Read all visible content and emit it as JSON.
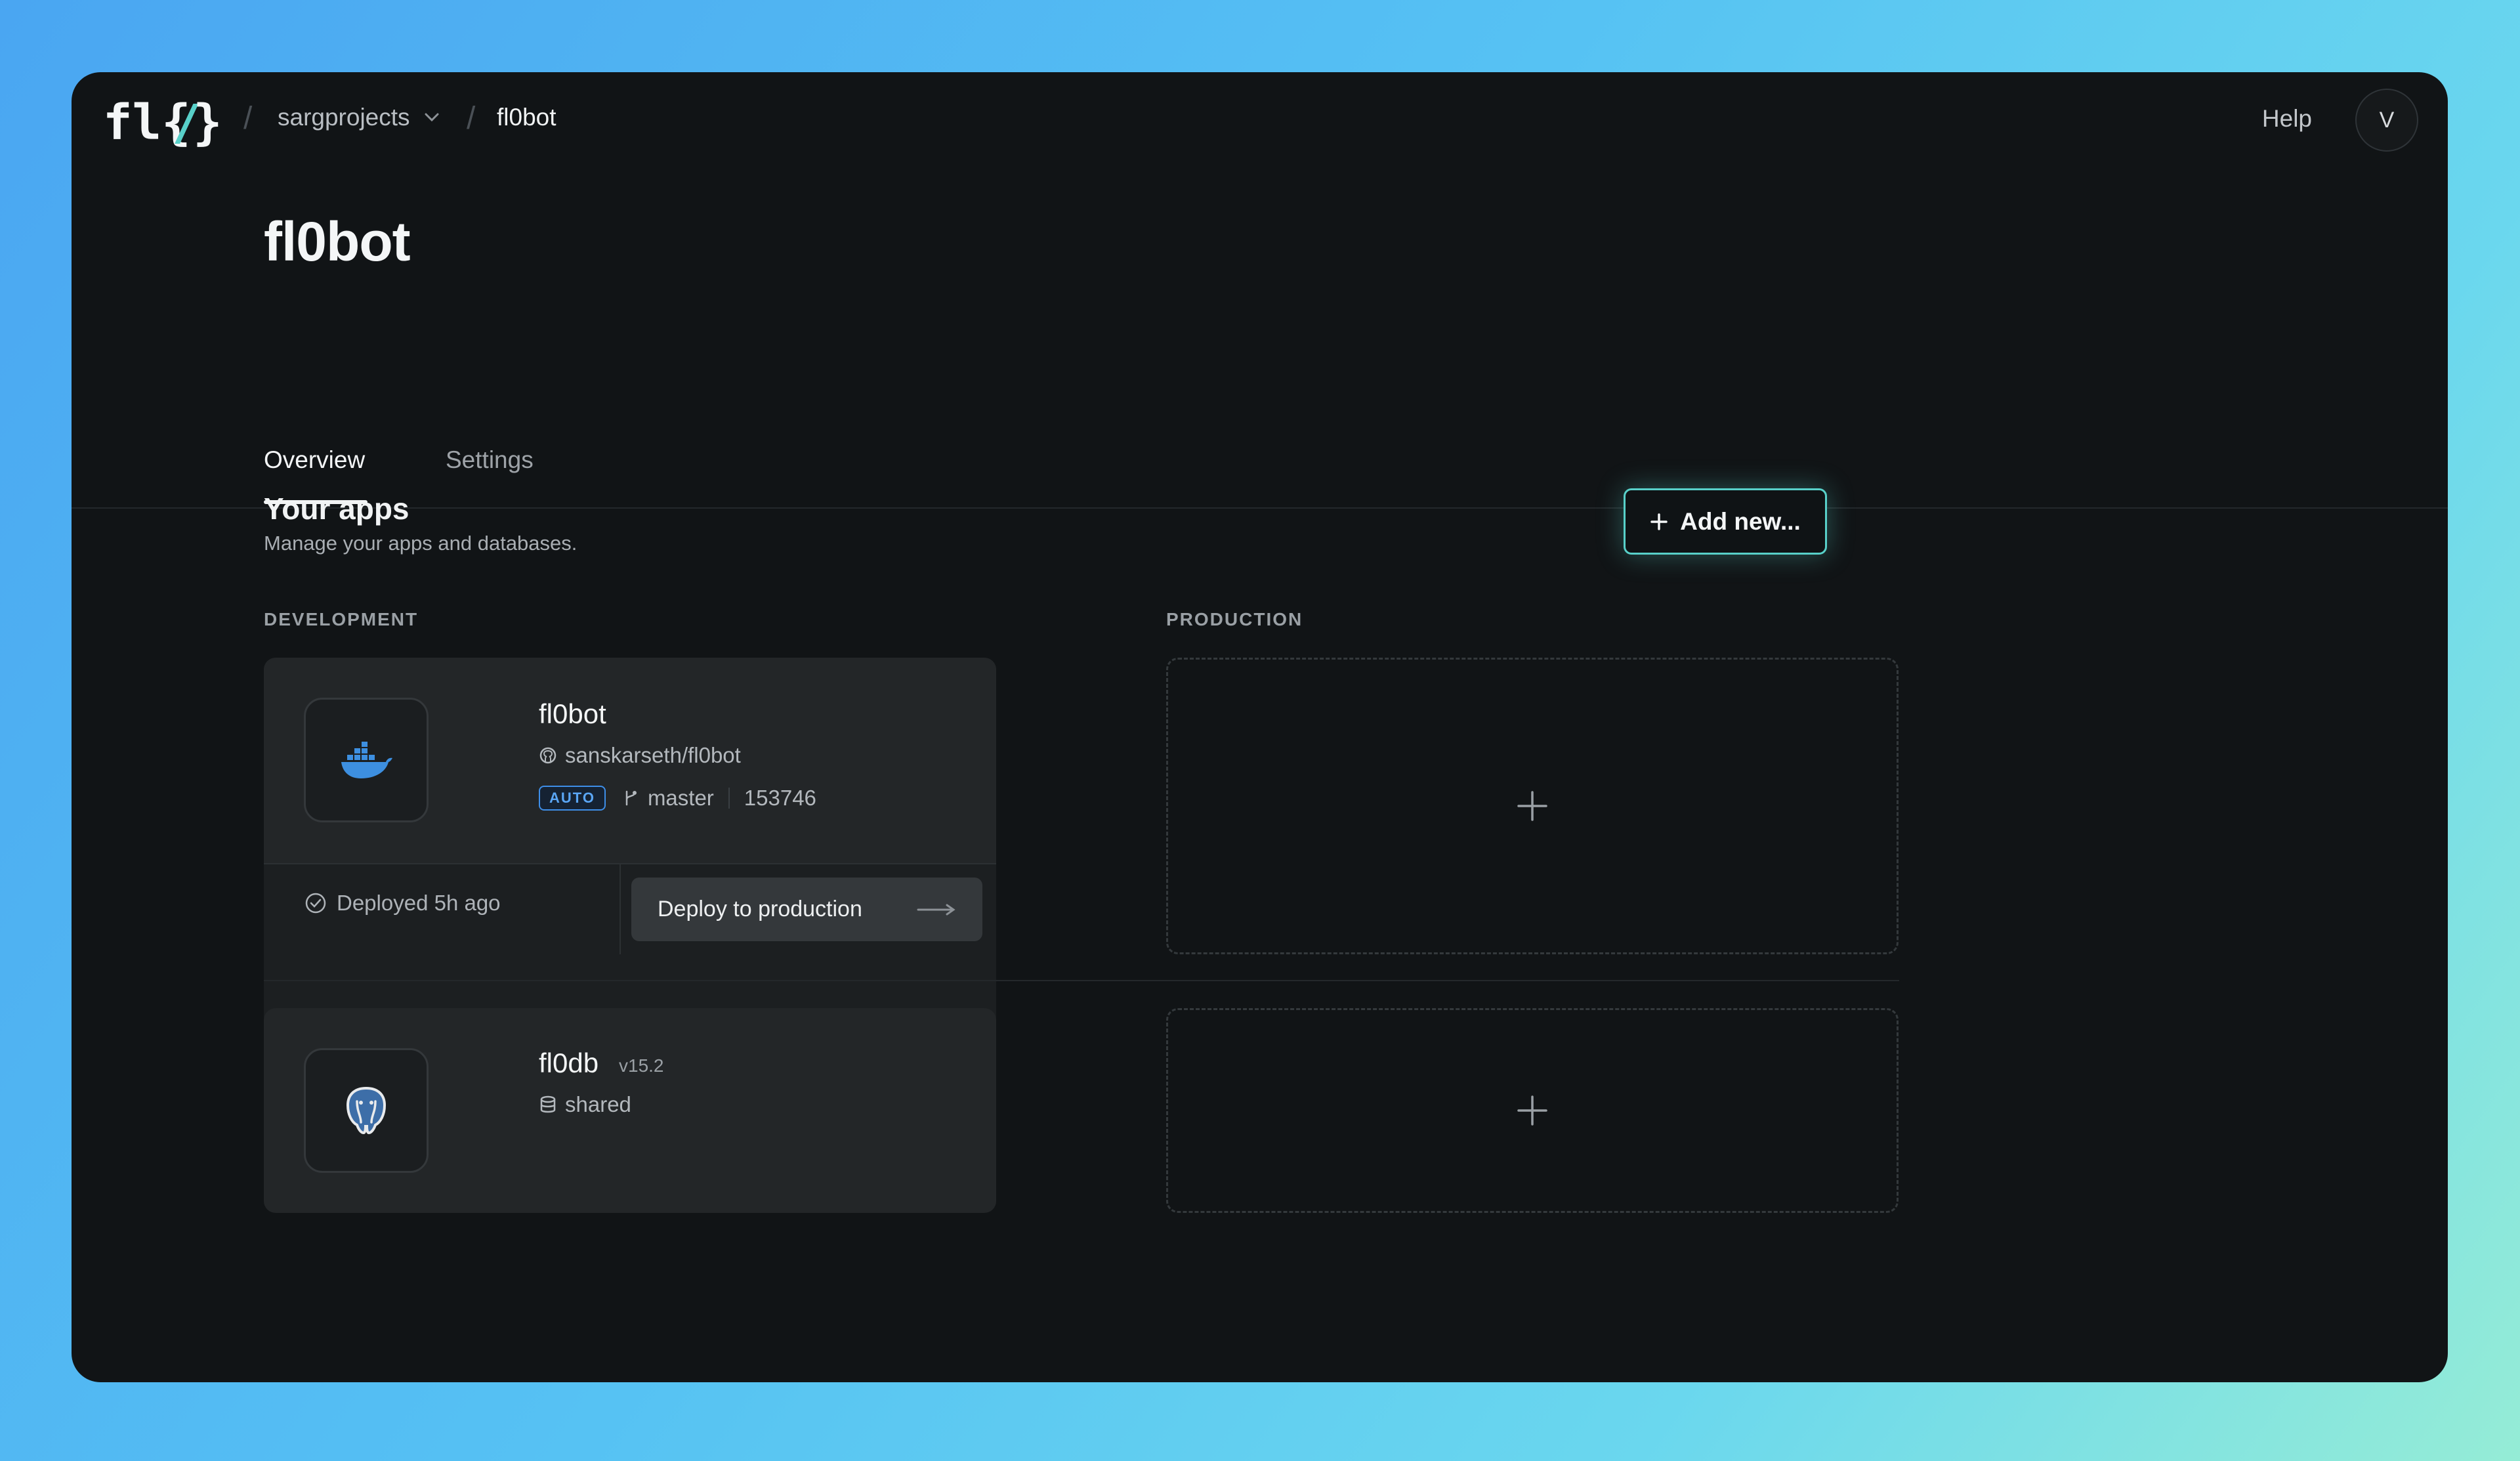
{
  "breadcrumb": {
    "org": "sargprojects",
    "project": "fl0bot"
  },
  "header": {
    "help_label": "Help",
    "avatar_initial": "V"
  },
  "page": {
    "title": "fl0bot",
    "tabs": [
      {
        "label": "Overview",
        "active": true
      },
      {
        "label": "Settings",
        "active": false
      }
    ]
  },
  "apps_section": {
    "title": "Your apps",
    "subtitle": "Manage your apps and databases.",
    "add_button_label": "Add new...",
    "development_label": "DEVELOPMENT",
    "production_label": "PRODUCTION"
  },
  "apps": [
    {
      "name": "fl0bot",
      "icon": "docker-icon",
      "repo": "sanskarseth/fl0bot",
      "badge": "AUTO",
      "branch": "master",
      "commit": "153746",
      "status": "Deployed 5h ago",
      "action_label": "Deploy to production"
    },
    {
      "name": "fl0db",
      "version": "v15.2",
      "icon": "postgres-icon",
      "type": "shared"
    }
  ],
  "colors": {
    "accent": "#58d0c9",
    "window_bg": "#111416",
    "card_bg": "#232628",
    "badge_blue": "#3e8ee8"
  }
}
